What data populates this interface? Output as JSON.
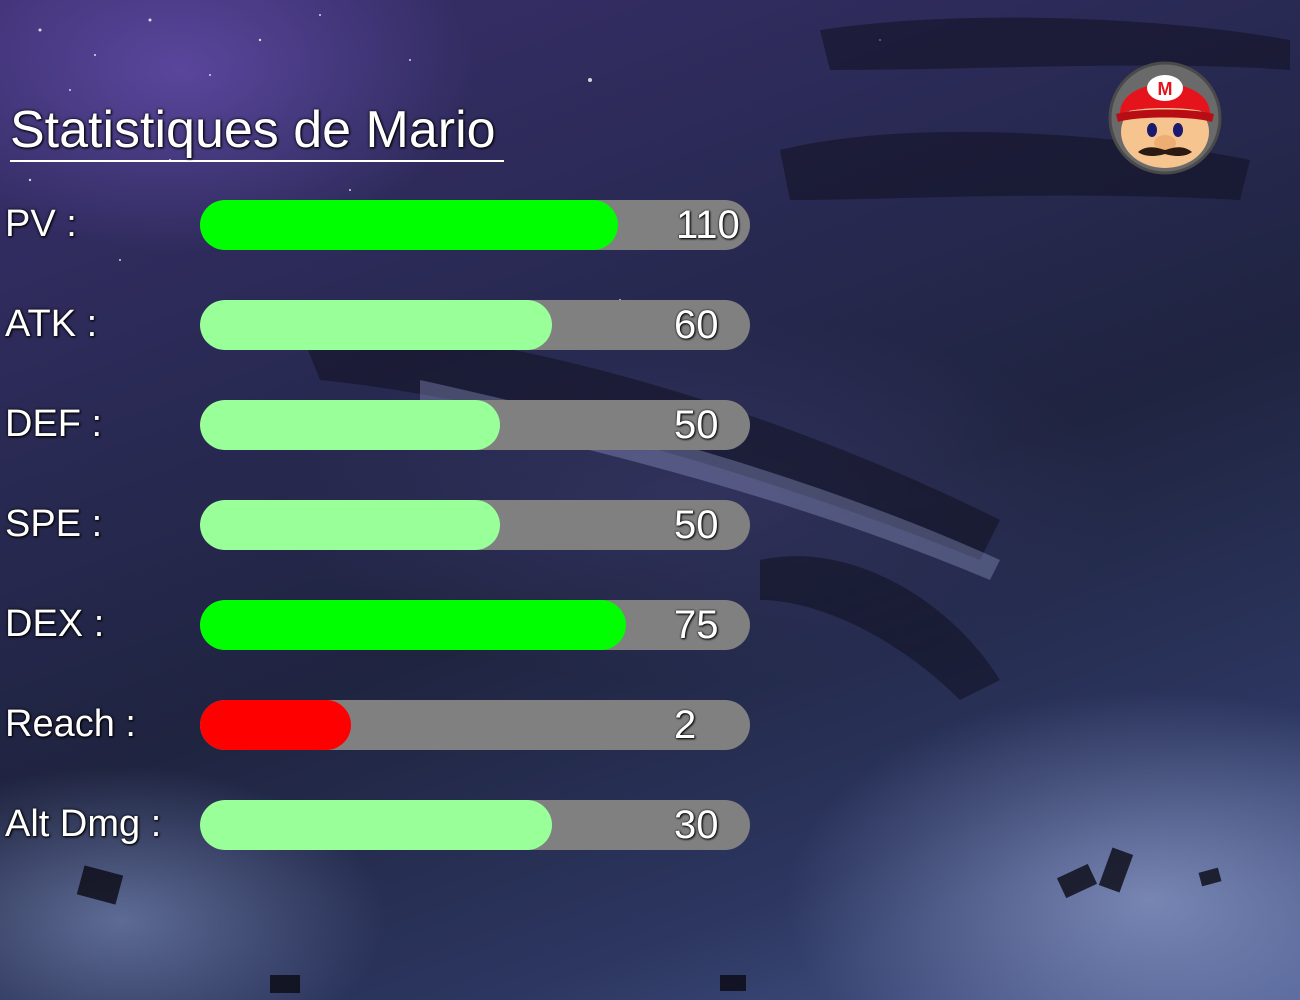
{
  "title": "Statistiques de Mario",
  "portrait": {
    "icon": "mario-face-icon",
    "emblem_letter": "M"
  },
  "colors": {
    "bar_track": "#808080",
    "high": "#00ff00",
    "medium": "#99ff99",
    "low": "#ff0000",
    "text": "#ffffff"
  },
  "stats": [
    {
      "label": "PV :",
      "value": "110",
      "level": "high",
      "fill_fraction": 0.76
    },
    {
      "label": "ATK :",
      "value": "60",
      "level": "medium",
      "fill_fraction": 0.64
    },
    {
      "label": "DEF :",
      "value": "50",
      "level": "medium",
      "fill_fraction": 0.545
    },
    {
      "label": "SPE :",
      "value": "50",
      "level": "medium",
      "fill_fraction": 0.545
    },
    {
      "label": "DEX :",
      "value": "75",
      "level": "high",
      "fill_fraction": 0.775
    },
    {
      "label": "Reach :",
      "value": "2",
      "level": "low",
      "fill_fraction": 0.275
    },
    {
      "label": "Alt Dmg :",
      "value": "30",
      "level": "medium",
      "fill_fraction": 0.64
    }
  ]
}
